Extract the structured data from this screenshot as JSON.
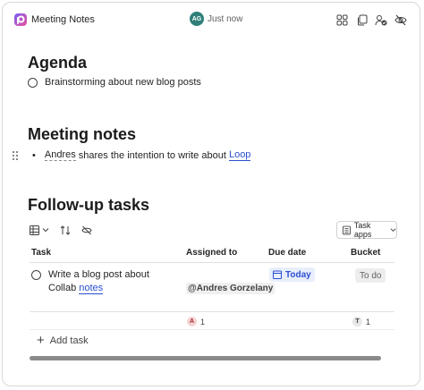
{
  "header": {
    "page_title": "Meeting Notes",
    "avatar_initials": "AG",
    "presence_time": "Just now",
    "icons": [
      "apps-icon",
      "copy-page-icon",
      "share-people-icon",
      "hide-icon"
    ]
  },
  "agenda": {
    "title": "Agenda",
    "items": [
      {
        "label": "Brainstorming about new blog posts"
      }
    ]
  },
  "meeting_notes": {
    "title": "Meeting notes",
    "bullet": "•",
    "mention": "Andres",
    "text": "shares the intention to write about",
    "link": "Loop"
  },
  "followup": {
    "title": "Follow-up tasks",
    "task_apps_label": "Task apps",
    "columns": [
      "Task",
      "Assigned to",
      "Due date",
      "Bucket"
    ],
    "rows": [
      {
        "task_text": "Write a blog post about Collab",
        "task_link": "notes",
        "assigned_to": "@Andres Gorzelany",
        "due_date": "Today",
        "bucket": "To do"
      }
    ],
    "summary": {
      "assigned_initial": "A",
      "assigned_count": "1",
      "bucket_initial": "T",
      "bucket_count": "1"
    },
    "add_task_label": "Add task"
  },
  "colors": {
    "accent": "#2b4fd1",
    "avatar": "#2f7f7a",
    "due_pill_bg": "#e8eefc",
    "bucket_pill_bg": "#ededed"
  }
}
